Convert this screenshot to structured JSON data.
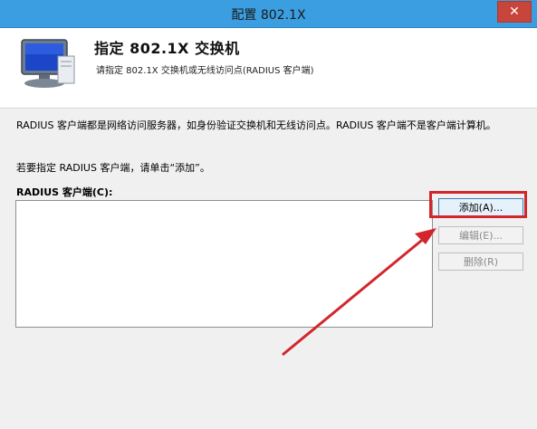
{
  "window": {
    "title": "配置 802.1X",
    "close_glyph": "✕"
  },
  "header": {
    "title": "指定 802.1X 交换机",
    "subtitle": "请指定 802.1X 交换机或无线访问点(RADIUS 客户端)"
  },
  "body": {
    "description": "RADIUS 客户端都是网络访问服务器，如身份验证交换机和无线访问点。RADIUS 客户端不是客户端计算机。",
    "instruction": "若要指定 RADIUS 客户端，请单击“添加”。",
    "list_label": "RADIUS 客户端(C):"
  },
  "buttons": {
    "add": "添加(A)...",
    "edit": "编辑(E)...",
    "remove": "删除(R)"
  },
  "colors": {
    "titlebar": "#3b9ee0",
    "highlight": "#d2262c"
  }
}
